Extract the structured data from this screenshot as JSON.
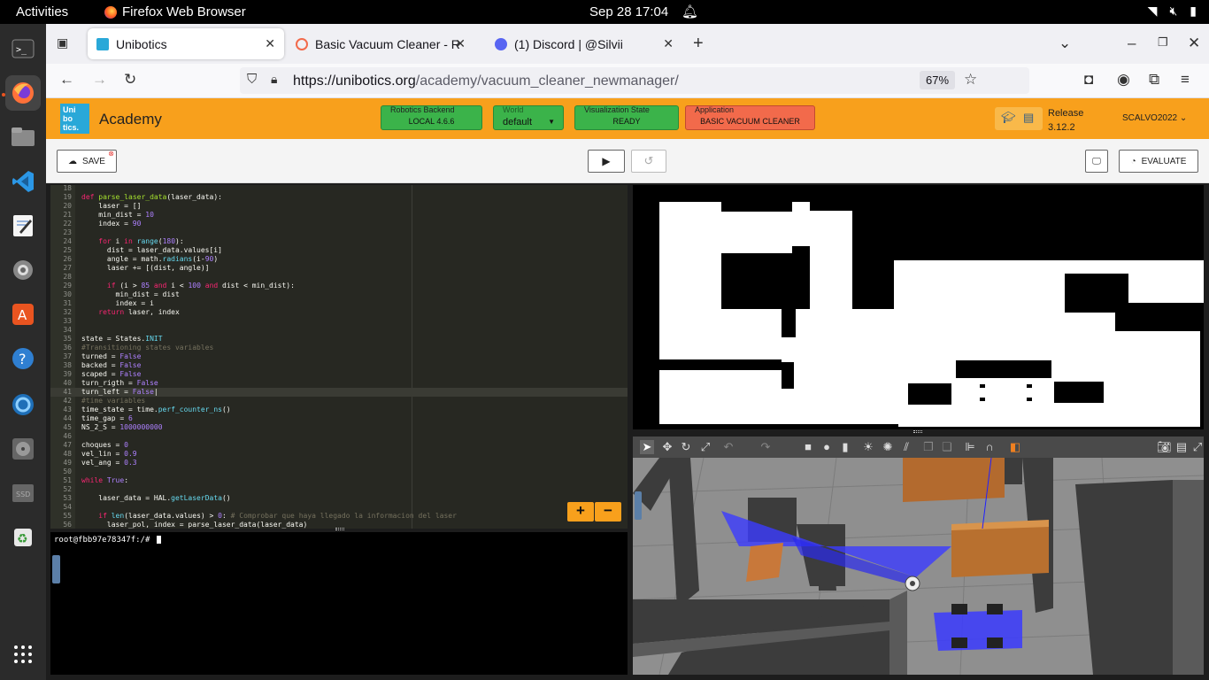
{
  "topbar": {
    "activities": "Activities",
    "app_name": "Firefox Web Browser",
    "clock": "Sep 28  17:04"
  },
  "browser": {
    "tabs": [
      {
        "label": "Unibotics",
        "active": true
      },
      {
        "label": "Basic Vacuum Cleaner - R"
      },
      {
        "label": "(1) Discord | @Silvii"
      }
    ],
    "url_host": "https://unibotics.org",
    "url_path": "/academy/vacuum_cleaner_newmanager/",
    "zoom": "67%"
  },
  "academy": {
    "title": "Academy",
    "robotics_backend": {
      "caption": "Robotics Backend",
      "value": "LOCAL 4.6.6"
    },
    "world": {
      "caption": "World",
      "value": "default"
    },
    "visualization": {
      "caption": "Visualization State",
      "value": "READY"
    },
    "application": {
      "caption": "Application",
      "value": "BASIC VACUUM CLEANER"
    },
    "release_label": "Release",
    "release_value": "3.12.2",
    "user": "SCALVO2022"
  },
  "toolbar": {
    "save_label": "SAVE",
    "evaluate_label": "EVALUATE"
  },
  "terminal": {
    "prompt": "root@fbb97e78347f:/#"
  },
  "colors": {
    "accent": "#f8a01c",
    "green_button": "#3bb34a",
    "red_button": "#f26a4b",
    "editor_bg": "#272822"
  }
}
